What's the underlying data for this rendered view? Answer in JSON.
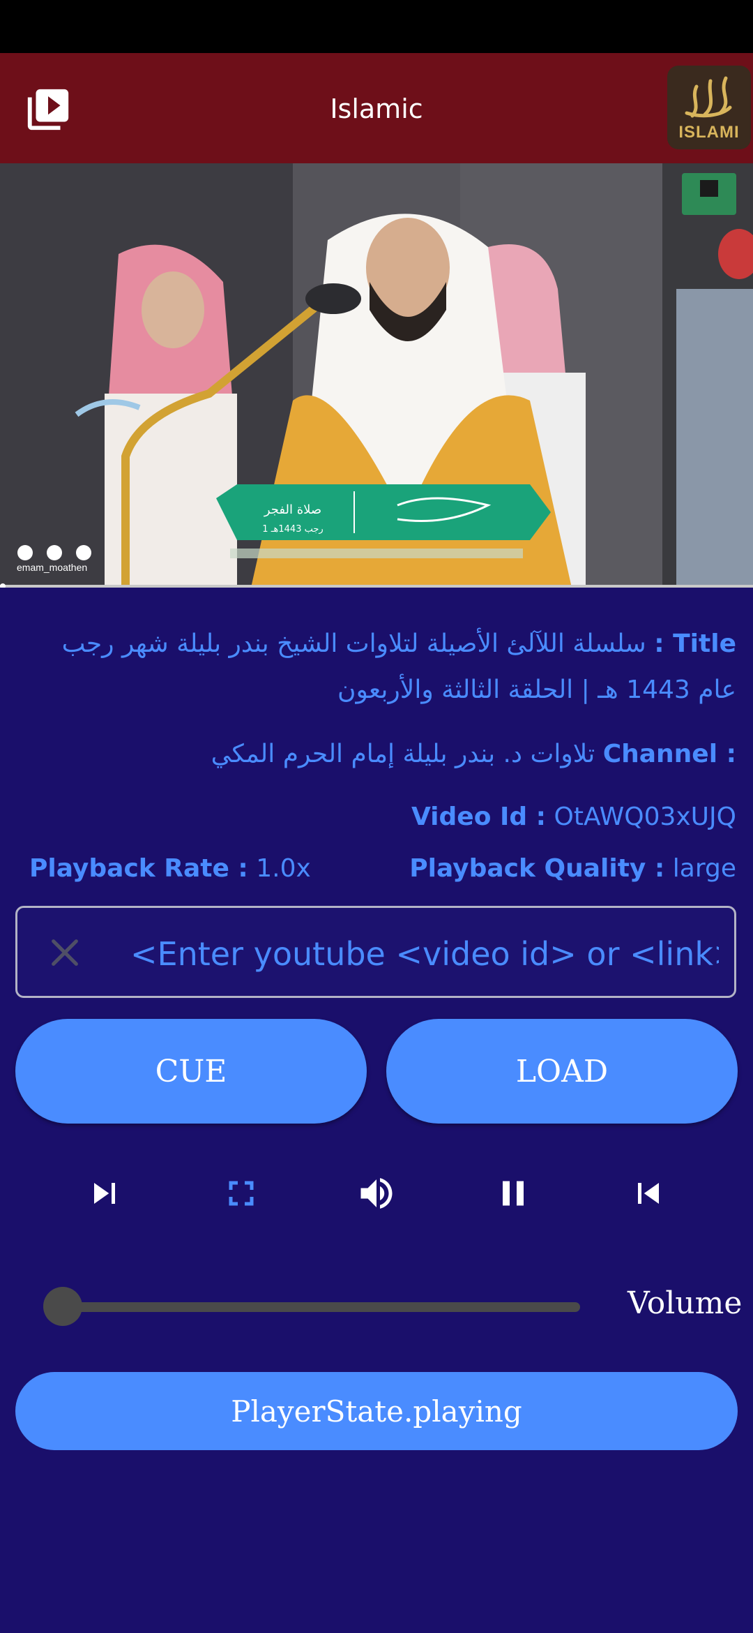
{
  "appbar": {
    "title": "Islamic",
    "logo_text": "ISLAMI"
  },
  "video": {
    "watermark": "emam_moathen",
    "banner_prayer": "صلاة الفجر",
    "banner_date": "1 رجب 1443هـ"
  },
  "info": {
    "title_label": "Title :",
    "title_value": "سلسلة اللآلئ الأصيلة لتلاوات الشيخ بندر بليلة شهر رجب عام 1443 هـ | الحلقة الثالثة والأربعون",
    "channel_label": "Channel :",
    "channel_value": "تلاوات د. بندر بليلة إمام الحرم المكي",
    "video_id_label": "Video Id :",
    "video_id_value": "OtAWQ03xUJQ",
    "rate_label": "Playback Rate :",
    "rate_value": "1.0x",
    "quality_label": "Playback Quality :",
    "quality_value": "large"
  },
  "input": {
    "placeholder": "<Enter youtube <video id> or <link>"
  },
  "buttons": {
    "cue": "CUE",
    "load": "LOAD"
  },
  "controls": [
    "skip-next-icon",
    "fullscreen-icon",
    "volume-icon",
    "pause-icon",
    "skip-previous-icon"
  ],
  "volume": {
    "label": "Volume",
    "level": 0
  },
  "player_state": "PlayerState.playing",
  "colors": {
    "background": "#1a0f6b",
    "appbar": "#6e0f19",
    "accent": "#4a8cff"
  }
}
